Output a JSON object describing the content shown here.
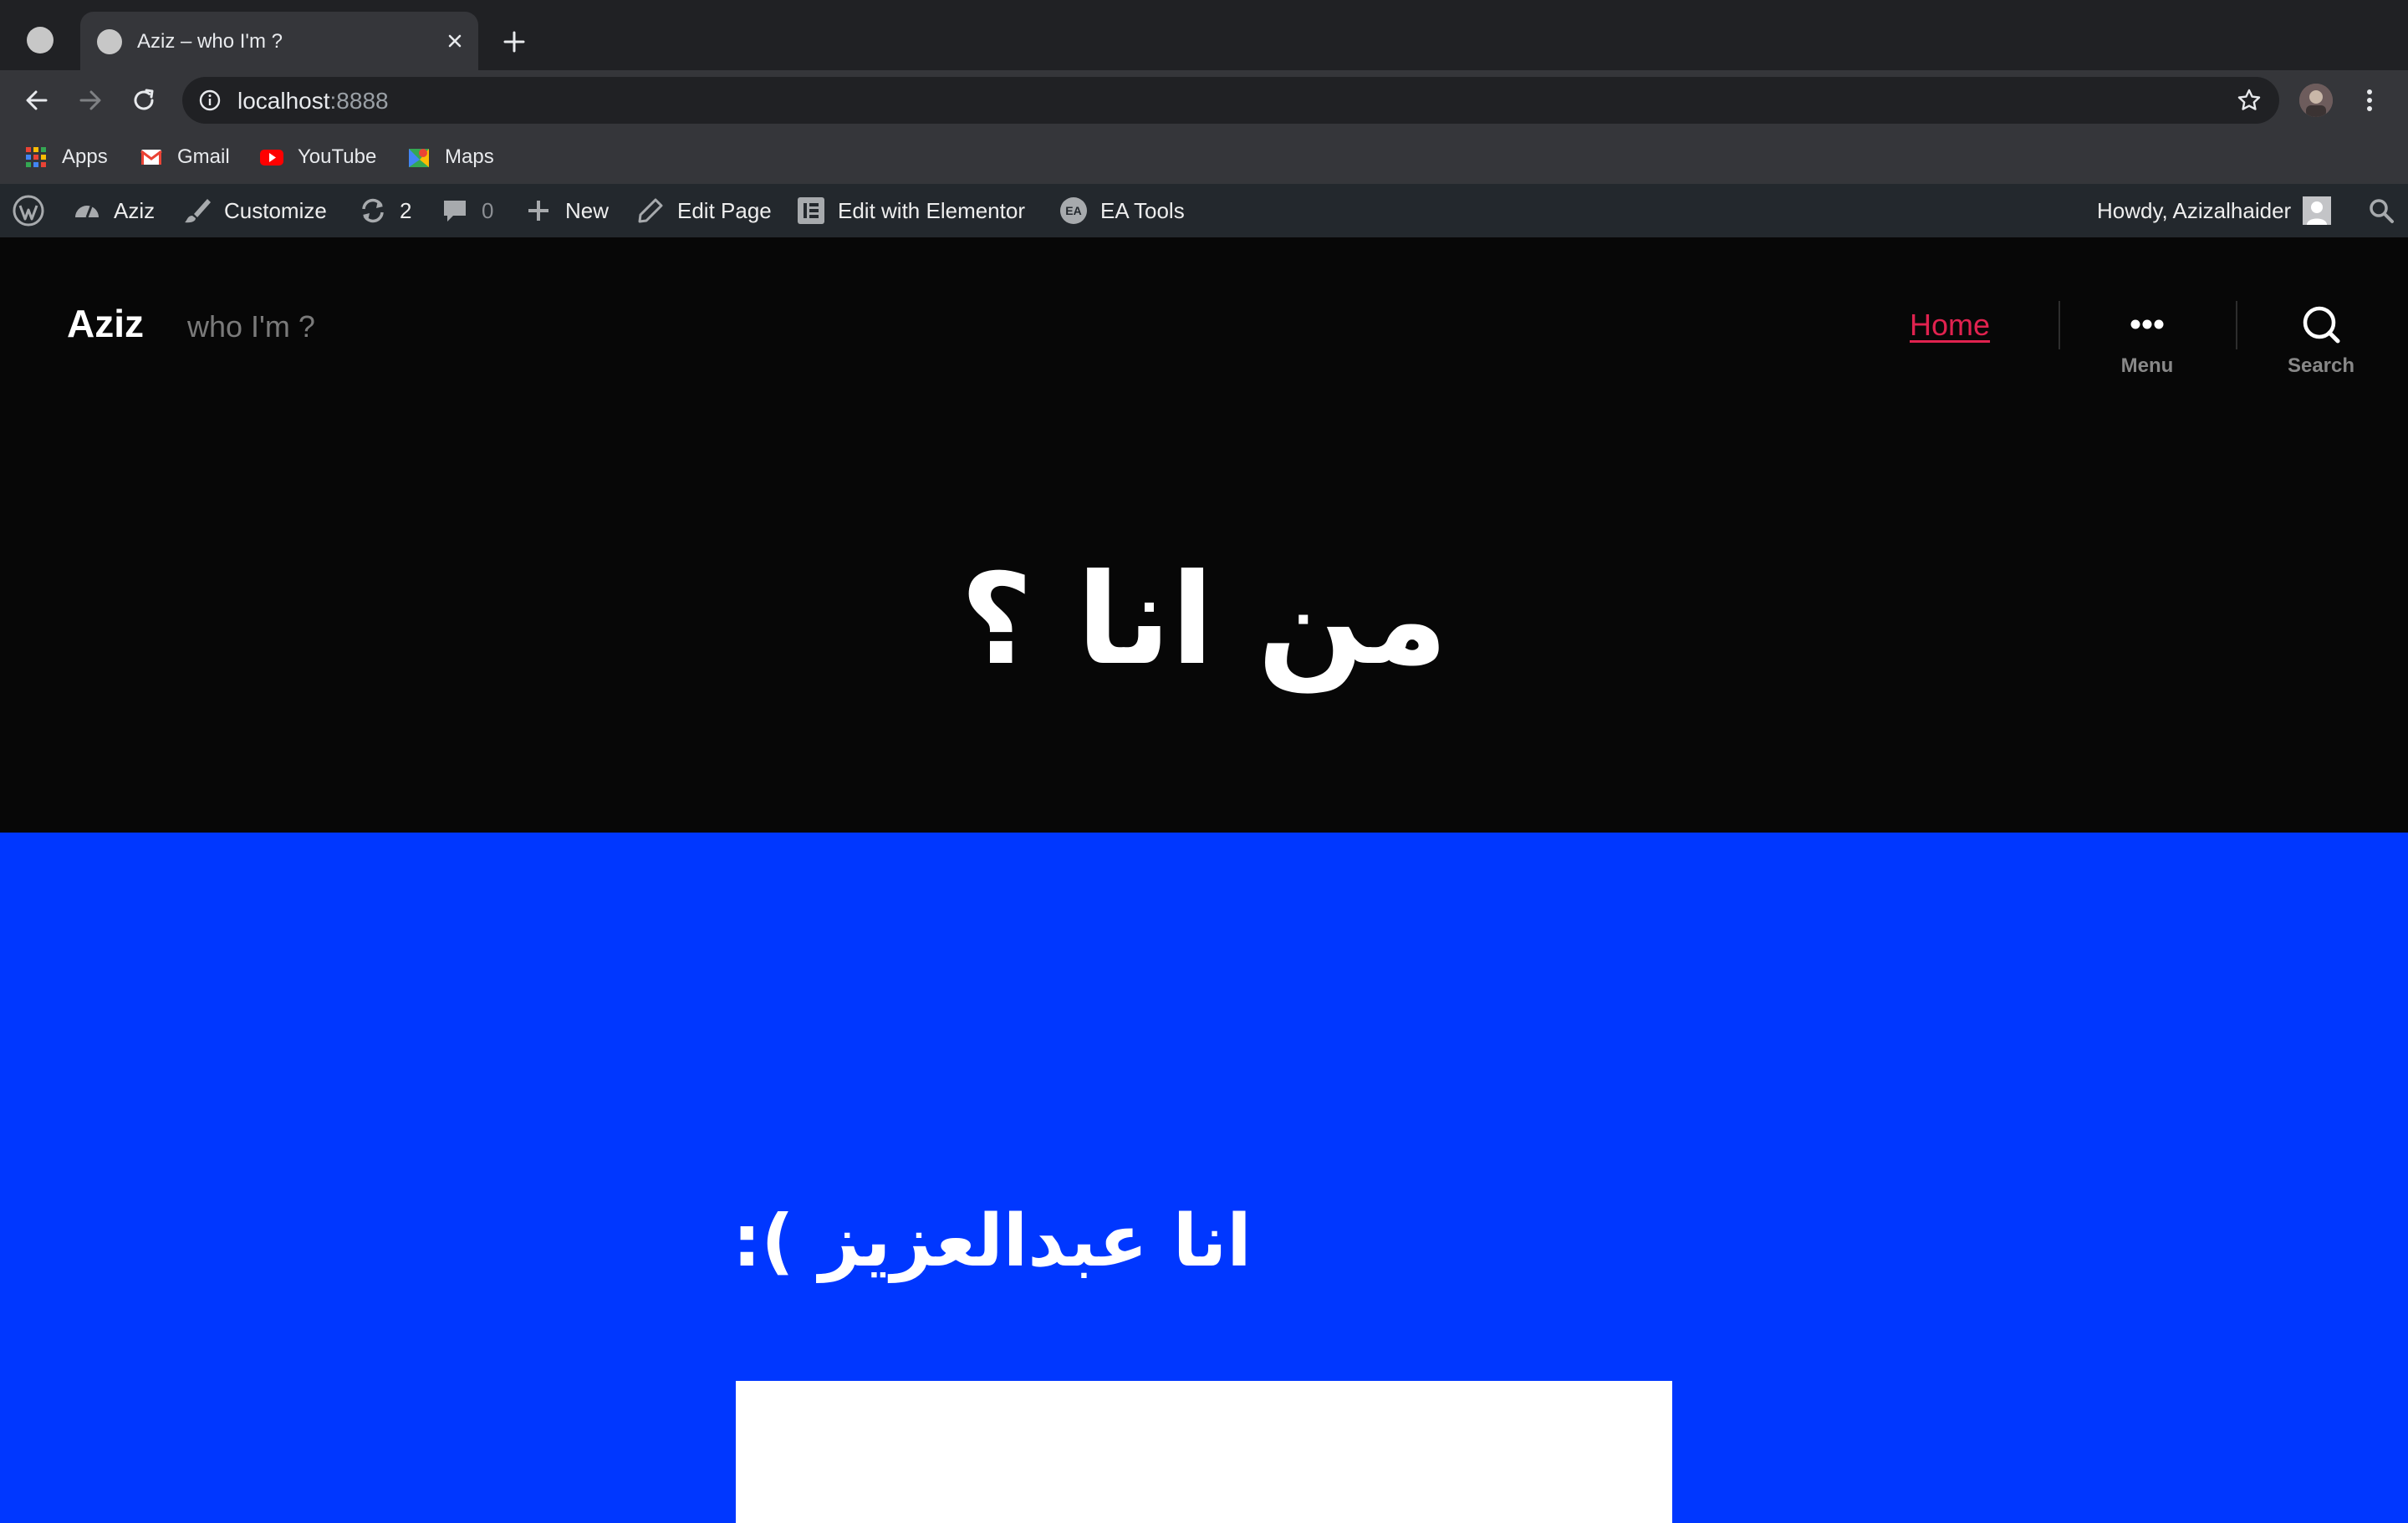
{
  "browser": {
    "tab": {
      "title": "Aziz – who I'm ?"
    },
    "address": {
      "host": "localhost",
      "port": ":8888"
    },
    "bookmarks": [
      "Apps",
      "Gmail",
      "YouTube",
      "Maps"
    ]
  },
  "adminbar": {
    "site": "Aziz",
    "customize": "Customize",
    "updates_count": "2",
    "comments_count": "0",
    "new": "New",
    "edit_page": "Edit Page",
    "edit_elementor": "Edit with Elementor",
    "ea_tools": "EA Tools",
    "ea_badge": "EA",
    "howdy": "Howdy, Azizalhaider"
  },
  "site": {
    "title": "Aziz",
    "description": "who I'm ?",
    "nav_home": "Home",
    "menu_label": "Menu",
    "search_label": "Search",
    "hero_title": "من انا ؟",
    "section_heading": "انا عبدالعزيز ):"
  },
  "colors": {
    "accent_link": "#e0224f",
    "content_bg": "#0037ff",
    "header_bg": "#070707",
    "adminbar_bg": "#23282d"
  }
}
